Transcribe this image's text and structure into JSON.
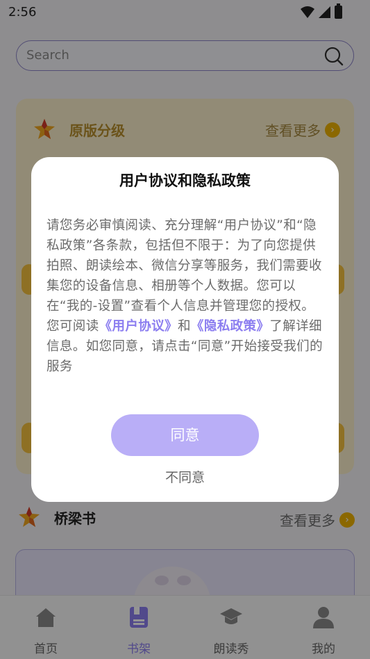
{
  "status_bar": {
    "time": "2:56"
  },
  "search": {
    "placeholder": "Search"
  },
  "section_original": {
    "title": "原版分级",
    "more": "查看更多"
  },
  "section_bridge": {
    "title": "桥梁书",
    "more": "查看更多"
  },
  "tabs": [
    {
      "label": "首页",
      "icon": "home-icon"
    },
    {
      "label": "书架",
      "icon": "bookshelf-icon",
      "active": true
    },
    {
      "label": "朗读秀",
      "icon": "graduation-cap-icon"
    },
    {
      "label": "我的",
      "icon": "profile-icon"
    }
  ],
  "dialog": {
    "title": "用户协议和隐私政策",
    "paragraph1": "请您务必审慎阅读、充分理解“用户协议”和“隐私政策”各条款，包括但不限于：为了向您提供拍照、朗读绘本、微信分享等服务，我们需要收集您的设备信息、相册等个人数据。您可以在“我的-设置”查看个人信息并管理您的授权。",
    "p2_prefix": "您可阅读",
    "link_user_agreement": "《用户协议》",
    "p2_and": "和",
    "link_privacy_policy": "《隐私政策》",
    "p2_suffix": "了解详细信息。如您同意，请点击“同意”开始接受我们的服务",
    "agree": "同意",
    "disagree": "不同意"
  },
  "colors": {
    "accent": "#8c7ef0",
    "agree_button": "#b9aef7",
    "section_bg": "#fbefcc",
    "section_title": "#b8902d",
    "badge": "#f0b400"
  }
}
